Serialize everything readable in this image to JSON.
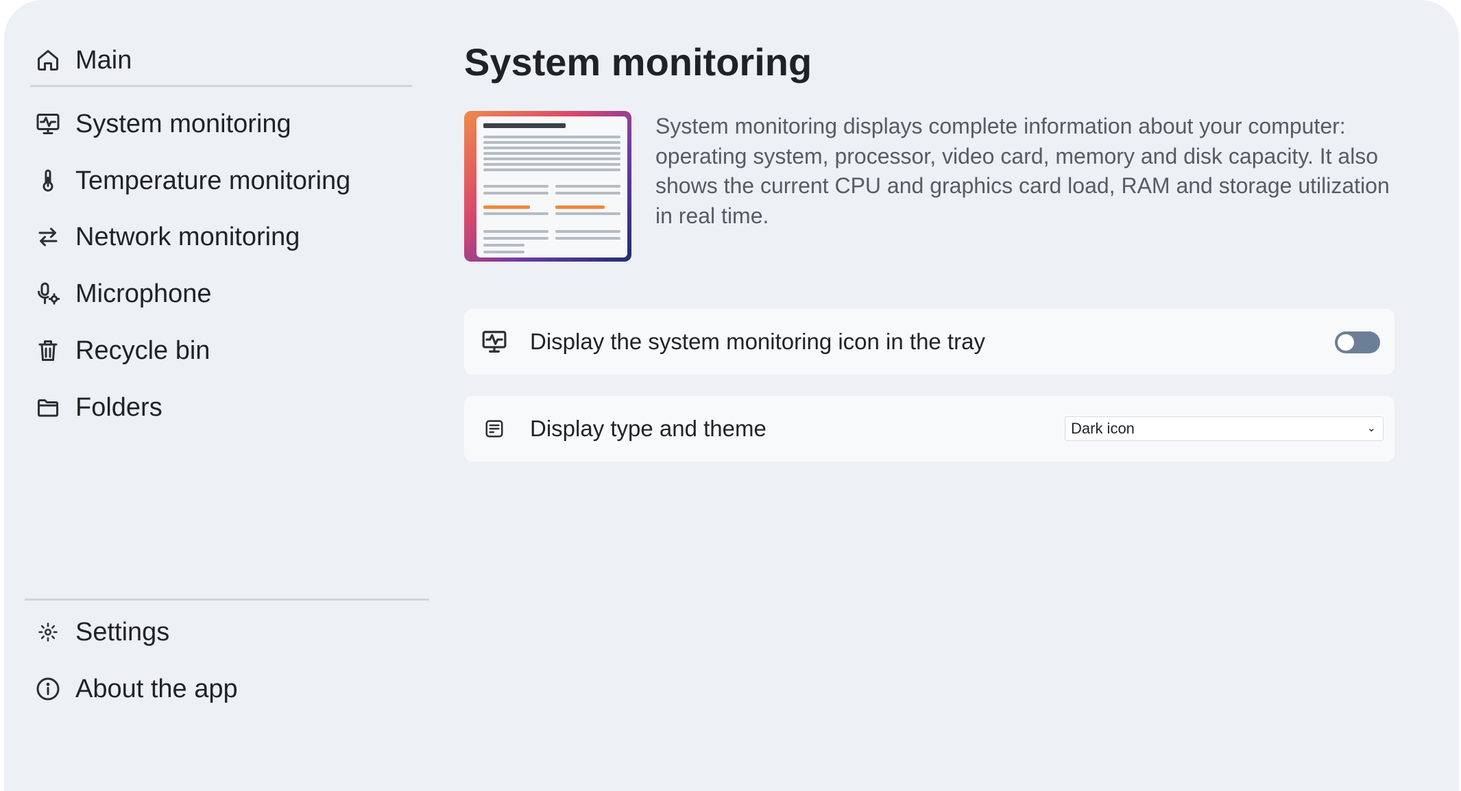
{
  "sidebar": {
    "items": [
      {
        "label": "Main",
        "icon": "home-icon"
      },
      {
        "label": "System monitoring",
        "icon": "monitor-pulse-icon"
      },
      {
        "label": "Temperature monitoring",
        "icon": "thermometer-icon"
      },
      {
        "label": "Network monitoring",
        "icon": "arrows-exchange-icon"
      },
      {
        "label": "Microphone",
        "icon": "microphone-settings-icon"
      },
      {
        "label": "Recycle bin",
        "icon": "trash-icon"
      },
      {
        "label": "Folders",
        "icon": "folder-icon"
      }
    ],
    "bottom_items": [
      {
        "label": "Settings",
        "icon": "gear-icon"
      },
      {
        "label": "About the app",
        "icon": "info-icon"
      }
    ]
  },
  "main": {
    "title": "System monitoring",
    "description": "System monitoring displays complete information about your computer: operating system, processor, video card, memory and disk capacity. It also shows the current CPU and graphics card load, RAM and storage utilization in real time.",
    "settings": [
      {
        "label": "Display the system monitoring icon in the tray",
        "icon": "monitor-pulse-icon",
        "control": "toggle",
        "value": false
      },
      {
        "label": "Display type and theme",
        "icon": "display-panel-icon",
        "control": "select",
        "value": "Dark icon"
      }
    ]
  },
  "colors": {
    "background": "#edf0f4",
    "card": "#f8f9fb",
    "toggle_off": "#6b7f96",
    "accent_orange": "#f0893a"
  }
}
